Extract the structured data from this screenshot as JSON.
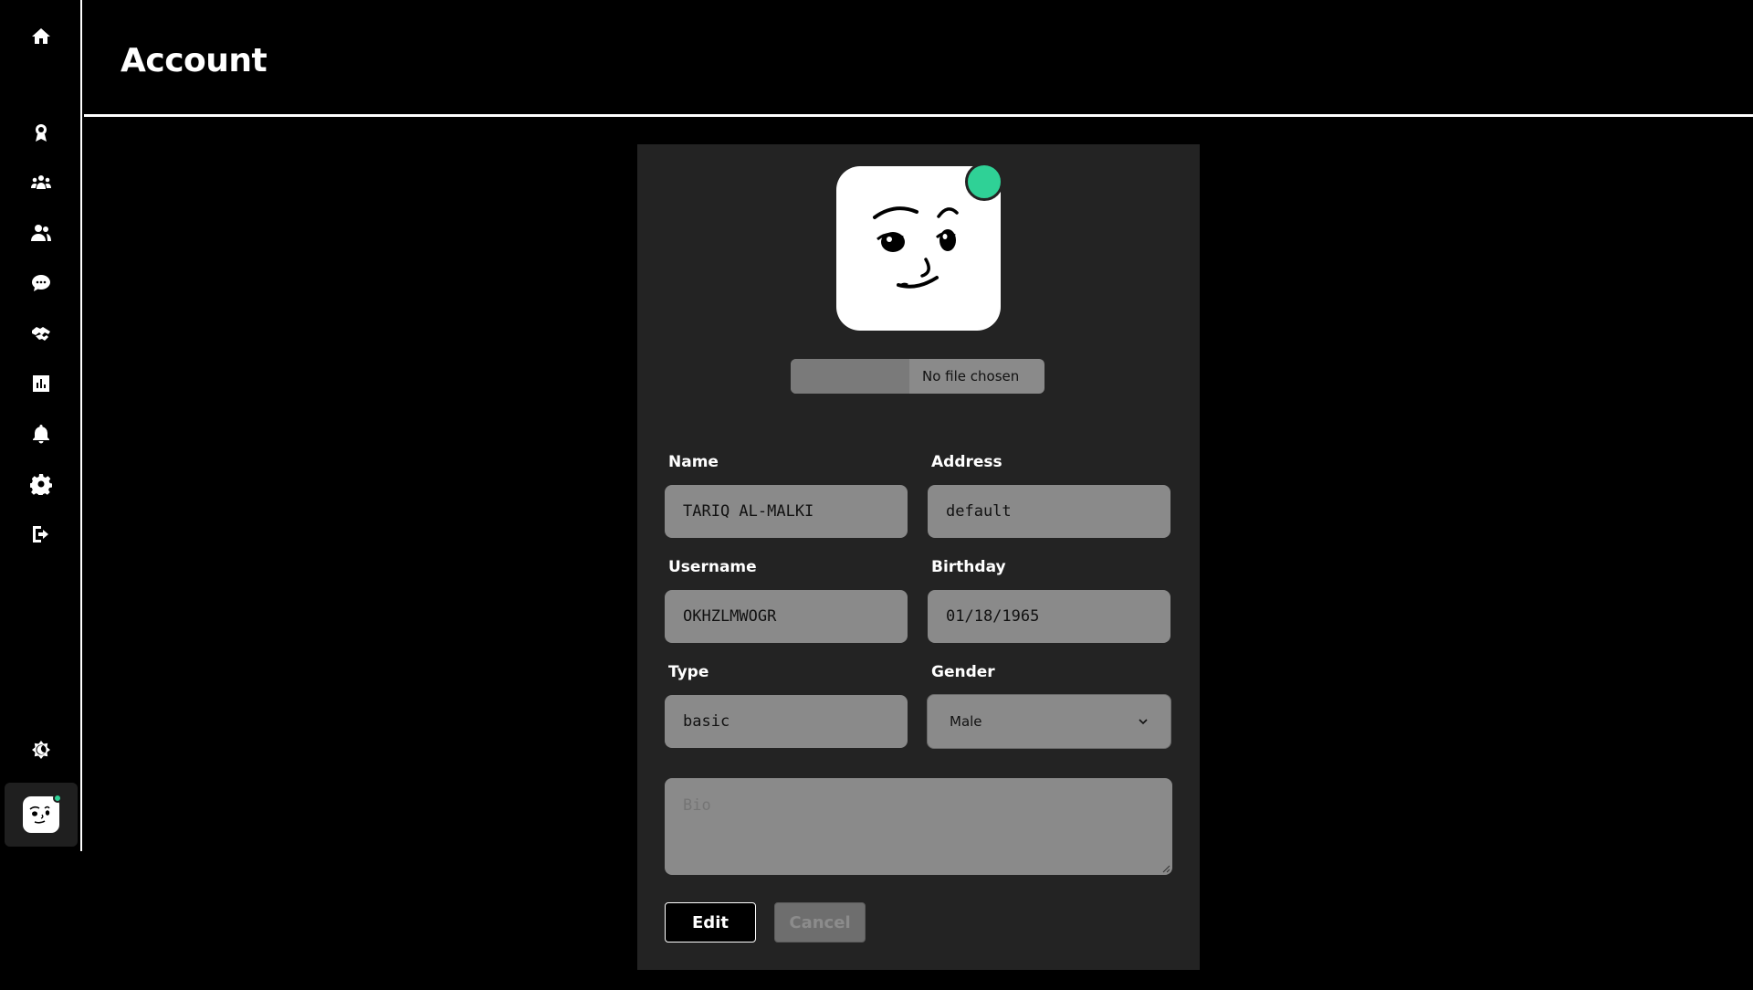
{
  "page": {
    "title": "Account"
  },
  "sidebar": {
    "icons": [
      "home-icon",
      "award-icon",
      "groups-icon",
      "friends-icon",
      "chat-icon",
      "handshake-icon",
      "chart-icon",
      "bell-icon",
      "gear-icon",
      "logout-icon",
      "theme-icon"
    ]
  },
  "profile": {
    "file_status": "No file chosen",
    "fields": {
      "name_label": "Name",
      "name_value": "TARIQ AL-MALKI",
      "address_label": "Address",
      "address_value": "default",
      "username_label": "Username",
      "username_value": "OKHZLMWOGR",
      "birthday_label": "Birthday",
      "birthday_value": "01/18/1965",
      "type_label": "Type",
      "type_value": "basic",
      "gender_label": "Gender",
      "gender_value": "Male"
    },
    "bio_placeholder": "Bio"
  },
  "actions": {
    "edit_label": "Edit",
    "cancel_label": "Cancel"
  },
  "colors": {
    "status": "#2fd196",
    "card": "#232323",
    "input": "#8a8a8a"
  }
}
